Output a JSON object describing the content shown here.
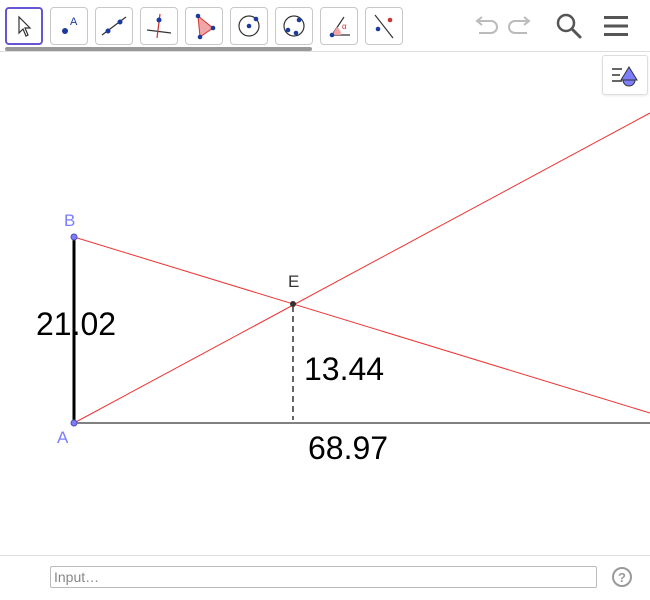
{
  "toolbar": {
    "tools": [
      {
        "name": "move-tool",
        "icon": "arrow-cursor-icon",
        "selected": true
      },
      {
        "name": "point-tool",
        "icon": "point-icon",
        "label": "A"
      },
      {
        "name": "line-tool",
        "icon": "line-through-points-icon"
      },
      {
        "name": "perpendicular-line-tool",
        "icon": "perpendicular-line-icon"
      },
      {
        "name": "polygon-tool",
        "icon": "polygon-icon"
      },
      {
        "name": "circle-center-point-tool",
        "icon": "circle-center-point-icon"
      },
      {
        "name": "circle-three-points-tool",
        "icon": "circle-three-points-icon"
      },
      {
        "name": "angle-tool",
        "icon": "angle-icon",
        "label": "α"
      },
      {
        "name": "reflect-tool",
        "icon": "reflect-about-line-icon"
      }
    ],
    "undo_icon": "undo-icon",
    "redo_icon": "redo-icon",
    "search_icon": "search-icon",
    "menu_icon": "hamburger-menu-icon"
  },
  "style_bar": {
    "icon": "style-bar-toggle-icon"
  },
  "graphics": {
    "points": {
      "A": "A",
      "B": "B",
      "E": "E"
    },
    "labels": {
      "ab_length": "21.02",
      "e_height": "13.44",
      "base_length": "68.97"
    },
    "colors": {
      "red_lines": "#ee3333",
      "point_label": "#7d7dff",
      "segment": "#000000",
      "point_fill": "#7d7dff"
    }
  },
  "input_bar": {
    "placeholder": "Input…",
    "help_label": "?"
  }
}
